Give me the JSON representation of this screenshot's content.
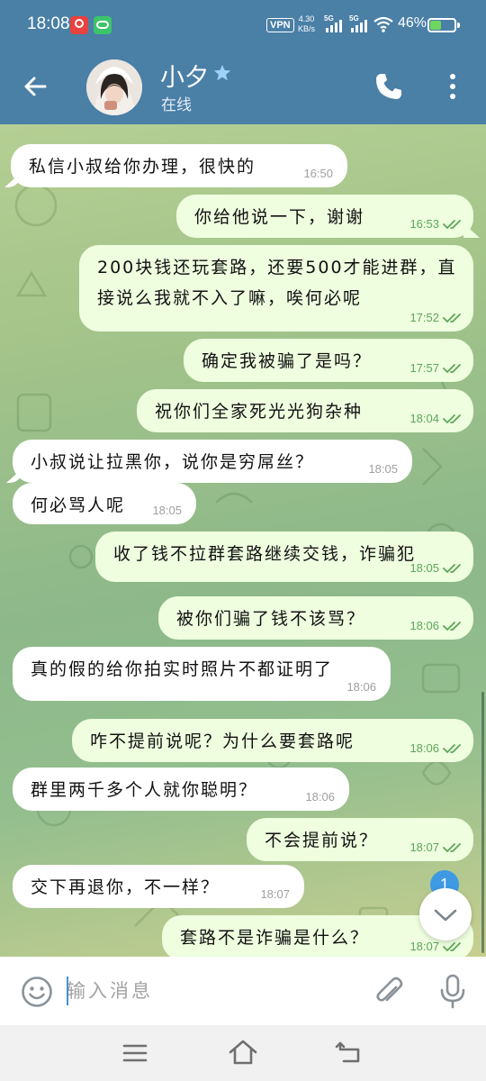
{
  "status_bar": {
    "time": "18:08",
    "vpn": "VPN",
    "net_speed_value": "4.30",
    "net_speed_unit": "KB/s",
    "sim1": "5G",
    "sim2": "5G",
    "battery": "46%",
    "battery_level": 0.46
  },
  "header": {
    "contact_name": "小夕",
    "contact_status": "在线"
  },
  "messages": [
    {
      "dir": "in",
      "text": "私信小叔给你办理，很快的",
      "time": "16:50"
    },
    {
      "dir": "out",
      "text": "你给他说一下，谢谢",
      "time": "16:53"
    },
    {
      "dir": "out",
      "text": "200块钱还玩套路，还要500才能进群，直接说么我就不入了嘛，唉何必呢",
      "time": "17:52"
    },
    {
      "dir": "out",
      "text": "确定我被骗了是吗？",
      "time": "17:57"
    },
    {
      "dir": "out",
      "text": "祝你们全家死光光狗杂种",
      "time": "18:04"
    },
    {
      "dir": "in",
      "text": "小叔说让拉黑你，说你是穷屌丝？",
      "time": "18:05"
    },
    {
      "dir": "in",
      "text": "何必骂人呢",
      "time": "18:05"
    },
    {
      "dir": "out",
      "text": "收了钱不拉群套路继续交钱，诈骗犯",
      "time": "18:05"
    },
    {
      "dir": "out",
      "text": "被你们骗了钱不该骂？",
      "time": "18:06"
    },
    {
      "dir": "in",
      "text": "真的假的给你拍实时照片不都证明了",
      "time": "18:06"
    },
    {
      "dir": "out",
      "text": "咋不提前说呢？为什么要套路呢",
      "time": "18:06"
    },
    {
      "dir": "in",
      "text": "群里两千多个人就你聪明？",
      "time": "18:06"
    },
    {
      "dir": "out",
      "text": "不会提前说？",
      "time": "18:07"
    },
    {
      "dir": "in",
      "text": "交下再退你，不一样？",
      "time": "18:07"
    },
    {
      "dir": "out",
      "text": "套路不是诈骗是什么？",
      "time": "18:07"
    }
  ],
  "unread_count": "1",
  "input": {
    "placeholder": "输入消息",
    "value": ""
  },
  "colors": {
    "header": "#4a7fa6",
    "incoming_bubble": "#ffffff",
    "outgoing_bubble": "#eefedf",
    "outgoing_time": "#5da55a",
    "badge": "#3e9ae3"
  },
  "icons": [
    "back-arrow-icon",
    "star-icon",
    "phone-icon",
    "more-vertical-icon",
    "emoji-icon",
    "paperclip-icon",
    "microphone-icon",
    "chevron-down-icon",
    "double-check-icon",
    "nav-menu-icon",
    "nav-home-icon",
    "nav-back-icon"
  ]
}
